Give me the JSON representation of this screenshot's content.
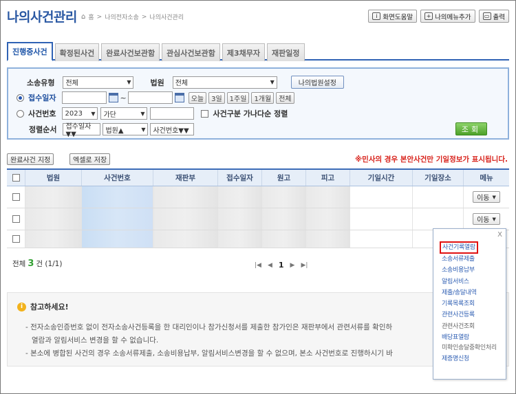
{
  "header": {
    "title": "나의사건관리",
    "breadcrumb": [
      "홈",
      "나의전자소송",
      "나의사건관리"
    ],
    "help_label": "화면도움말",
    "menu_add_label": "나의메뉴추가",
    "print_label": "출력"
  },
  "tabs": [
    "진행중사건",
    "확정된사건",
    "완료사건보관함",
    "관심사건보관함",
    "제3채무자",
    "재판일정"
  ],
  "search": {
    "case_type_label": "소송유형",
    "case_type_value": "전체",
    "court_label": "법원",
    "court_value": "전체",
    "my_court_btn": "나의법원설정",
    "date_label": "접수일자",
    "date_sep": "~",
    "period_buttons": [
      "오늘",
      "3일",
      "1주일",
      "1개월",
      "전체"
    ],
    "case_no_label": "사건번호",
    "year_value": "2023",
    "gubun_value": "가단",
    "sort_check_label": "사건구분 가나다순 정렬",
    "order_label": "정렬순서",
    "order_values": [
      "접수일자▼▼",
      "법원▲",
      "사건번호▼▼"
    ],
    "search_btn": "조회"
  },
  "actions": {
    "complete_btn": "완료사건 지정",
    "excel_btn": "엑셀로 저장",
    "notice": "※민사의 경우 본안사건만 기일정보가 표시됩니다."
  },
  "table": {
    "columns": [
      "법원",
      "사건번호",
      "재판부",
      "접수일자",
      "원고",
      "피고",
      "기일시간",
      "기일장소",
      "메뉴"
    ],
    "row_menu_label": "이동"
  },
  "footer": {
    "total_prefix": "전체",
    "total_count": "3",
    "total_suffix": "건 (1/1)",
    "current_page": "1"
  },
  "info": {
    "title": "참고하세요!",
    "lines": [
      "- 전자소송인증번호 없이 전자소송사건등록을 한 대리인이나 참가신청서를 제출한 참가인은 재판부에서 관련서류를 확인하",
      "열람과 알림서비스 변경을 할 수 없습니다.",
      "- 본소에 병합된 사건의 경우 소송서류제출, 소송비용납부, 알림서비스변경을 할 수 없으며, 본소 사건번호로 진행하시기 바"
    ]
  },
  "popup_menu": {
    "close_label": "X",
    "items": [
      "사건기록열람",
      "소송서류제출",
      "소송비용납부",
      "알림서비스",
      "제출/송달내역",
      "기록목록조회",
      "관련사건등록",
      "관련사건조회",
      "배당표열람",
      "미확인송달중확인처리",
      "제증명신청"
    ]
  }
}
